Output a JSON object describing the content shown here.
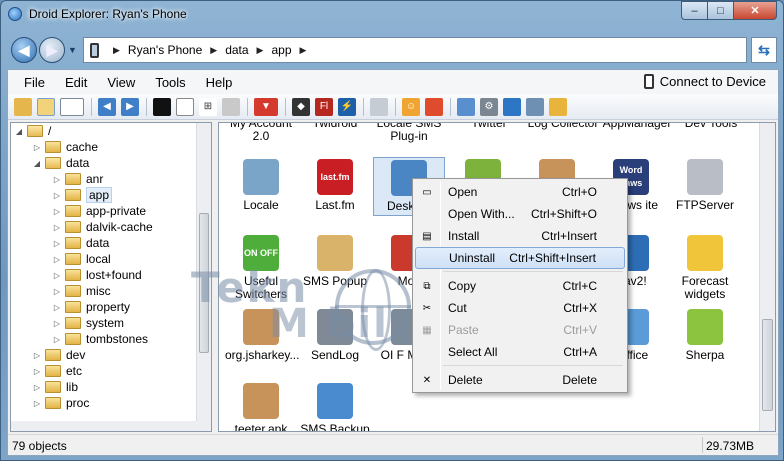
{
  "window": {
    "title": "Droid Explorer: Ryan's Phone",
    "minimize": "–",
    "maximize": "□",
    "close": "✕"
  },
  "address": {
    "crumbs": [
      "Ryan's Phone",
      "data",
      "app"
    ]
  },
  "menu": {
    "items": [
      "File",
      "Edit",
      "View",
      "Tools",
      "Help"
    ],
    "connect": "Connect to Device"
  },
  "tree": {
    "root": "/",
    "items": [
      {
        "label": "/",
        "arrow": "◢",
        "open": true
      },
      {
        "label": "cache",
        "arrow": "▷",
        "open": false
      },
      {
        "label": "data",
        "arrow": "◢",
        "open": true
      },
      {
        "label": "anr",
        "arrow": "▷",
        "open": false
      },
      {
        "label": "app",
        "arrow": "▷",
        "open": false,
        "selected": true
      },
      {
        "label": "app-private",
        "arrow": "▷",
        "open": false
      },
      {
        "label": "dalvik-cache",
        "arrow": "▷",
        "open": false
      },
      {
        "label": "data",
        "arrow": "▷",
        "open": false
      },
      {
        "label": "local",
        "arrow": "▷",
        "open": false
      },
      {
        "label": "lost+found",
        "arrow": "▷",
        "open": false
      },
      {
        "label": "misc",
        "arrow": "▷",
        "open": false
      },
      {
        "label": "property",
        "arrow": "▷",
        "open": false
      },
      {
        "label": "system",
        "arrow": "▷",
        "open": false
      },
      {
        "label": "tombstones",
        "arrow": "▷",
        "open": false
      },
      {
        "label": "dev",
        "arrow": "▷",
        "open": false
      },
      {
        "label": "etc",
        "arrow": "▷",
        "open": false
      },
      {
        "label": "lib",
        "arrow": "▷",
        "open": false
      },
      {
        "label": "proc",
        "arrow": "▷",
        "open": false
      }
    ]
  },
  "icons": {
    "partial_row": [
      "My Account 2.0",
      "Twidroid",
      "Locale SMS Plug-in",
      "Twitter",
      "Log Collector",
      "AppManager",
      "Dev Tools"
    ],
    "items": [
      {
        "label": "Locale",
        "icon": "locale-icon",
        "color": "#7aa4c8"
      },
      {
        "label": "Last.fm",
        "icon": "lastfm-icon",
        "color": "#c81e24",
        "text": "last.fm"
      },
      {
        "label": "Desktop",
        "icon": "desktop-icon",
        "color": "#4b86c4",
        "selected": true
      },
      {
        "label": "",
        "icon": "android-icon",
        "color": "#7db33c"
      },
      {
        "label": "",
        "icon": "package-icon",
        "color": "#c8935a"
      },
      {
        "label": "d Laws ite",
        "icon": "wordlaws-icon",
        "color": "#2a3f7a",
        "text": "Word Laws"
      },
      {
        "label": "FTPServer",
        "icon": "ftp-icon",
        "color": "#b9bec6"
      },
      {
        "label": "Useful Switchers",
        "icon": "switch-icon",
        "color": "#4fae3b",
        "text": "ON OFF"
      },
      {
        "label": "SMS Popup",
        "icon": "sms-popup-icon",
        "color": "#d9b36a"
      },
      {
        "label": "Mov",
        "icon": "movie-icon",
        "color": "#c93a2d"
      },
      {
        "label": "",
        "icon": "blank-icon",
        "color": "#ffffff"
      },
      {
        "label": "",
        "icon": "blank-icon",
        "color": "#ffffff"
      },
      {
        "label": "Nav2!",
        "icon": "nav-icon",
        "color": "#2d6db5",
        "badge": "2"
      },
      {
        "label": "Forecast widgets",
        "icon": "weather-icon",
        "color": "#f0c53a"
      },
      {
        "label": "org.jsharkey...",
        "icon": "package-icon",
        "color": "#c8935a"
      },
      {
        "label": "SendLog",
        "icon": "sendlog-icon",
        "color": "#7f8a96"
      },
      {
        "label": "OI F Mana",
        "icon": "oi-icon",
        "color": "#7c8b9a"
      },
      {
        "label": "",
        "icon": "blank-icon",
        "color": "#ffffff"
      },
      {
        "label": "",
        "icon": "blank-icon",
        "color": "#ffffff"
      },
      {
        "label": "koffice",
        "icon": "koffice-icon",
        "color": "#5a9bd8"
      },
      {
        "label": "Sherpa",
        "icon": "sherpa-icon",
        "color": "#8cc43f"
      },
      {
        "label": "teeter.apk",
        "icon": "package-icon",
        "color": "#c8935a"
      },
      {
        "label": "SMS Backup",
        "icon": "sms-backup-icon",
        "color": "#4a8bd0"
      }
    ]
  },
  "context_menu": {
    "items": [
      {
        "label": "Open",
        "key": "Ctrl+O",
        "icon": "folder-open-icon"
      },
      {
        "label": "Open With...",
        "key": "Ctrl+Shift+O",
        "icon": ""
      },
      {
        "label": "Install",
        "key": "Ctrl+Insert",
        "icon": "install-icon"
      },
      {
        "label": "Uninstall",
        "key": "Ctrl+Shift+Insert",
        "icon": "",
        "highlighted": true
      },
      {
        "label": "Copy",
        "key": "Ctrl+C",
        "icon": "copy-icon"
      },
      {
        "label": "Cut",
        "key": "Ctrl+X",
        "icon": "scissors-icon"
      },
      {
        "label": "Paste",
        "key": "Ctrl+V",
        "icon": "paste-icon",
        "disabled": true
      },
      {
        "label": "Select All",
        "key": "Ctrl+A",
        "icon": ""
      },
      {
        "label": "Delete",
        "key": "Delete",
        "icon": "delete-icon"
      }
    ]
  },
  "status": {
    "count": "79 objects",
    "size": "29.73MB"
  },
  "watermark": {
    "line1": "Tekn",
    "line2": "M bil"
  },
  "colors": {
    "selection": "#dbe8f6",
    "highlight_border": "#82a8d6",
    "folder": "#e2b448"
  }
}
